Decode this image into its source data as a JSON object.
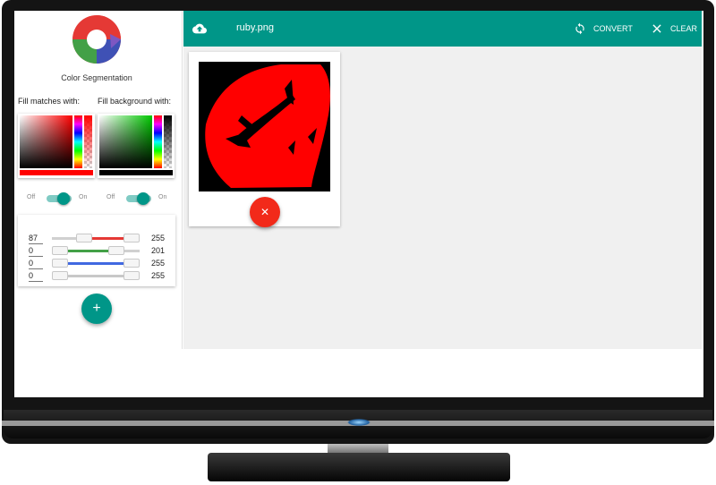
{
  "app": {
    "title": "Color Segmentation"
  },
  "pickers": {
    "fill_matches_label": "Fill matches with:",
    "fill_background_label": "Fill background with:",
    "match_color": "#ff0000",
    "background_color": "#000000"
  },
  "toggles": [
    {
      "off_label": "Off",
      "on_label": "On",
      "state": "on"
    },
    {
      "off_label": "Off",
      "on_label": "On",
      "state": "on"
    }
  ],
  "sliders": [
    {
      "min": "87",
      "max": "255",
      "color": "#e53935",
      "low": 87,
      "high": 255
    },
    {
      "min": "0",
      "max": "201",
      "color": "#43a047",
      "low": 0,
      "high": 201
    },
    {
      "min": "0",
      "max": "255",
      "color": "#4169e1",
      "low": 0,
      "high": 255
    },
    {
      "min": "0",
      "max": "255",
      "color": "#c8c8c8",
      "low": 0,
      "high": 255
    }
  ],
  "toolbar": {
    "filename": "ruby.png",
    "convert_label": "CONVERT",
    "clear_label": "CLEAR",
    "upload_icon": "cloud-upload-icon",
    "convert_icon": "refresh-icon",
    "clear_icon": "close-icon"
  },
  "colors": {
    "accent": "#009688",
    "danger": "#f22a1a"
  }
}
